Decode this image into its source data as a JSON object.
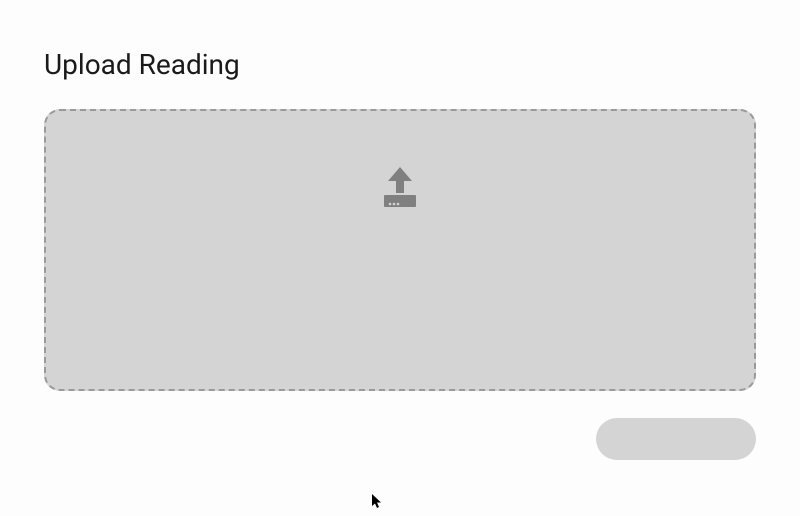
{
  "header": {
    "title": "Upload Reading"
  },
  "dropzone": {
    "icon_name": "upload-icon"
  },
  "actions": {
    "primary_label": ""
  },
  "colors": {
    "dropzone_bg": "#d4d4d4",
    "dropzone_border": "#9a9a9a",
    "button_bg": "#d4d4d4",
    "icon_fill": "#808080"
  }
}
